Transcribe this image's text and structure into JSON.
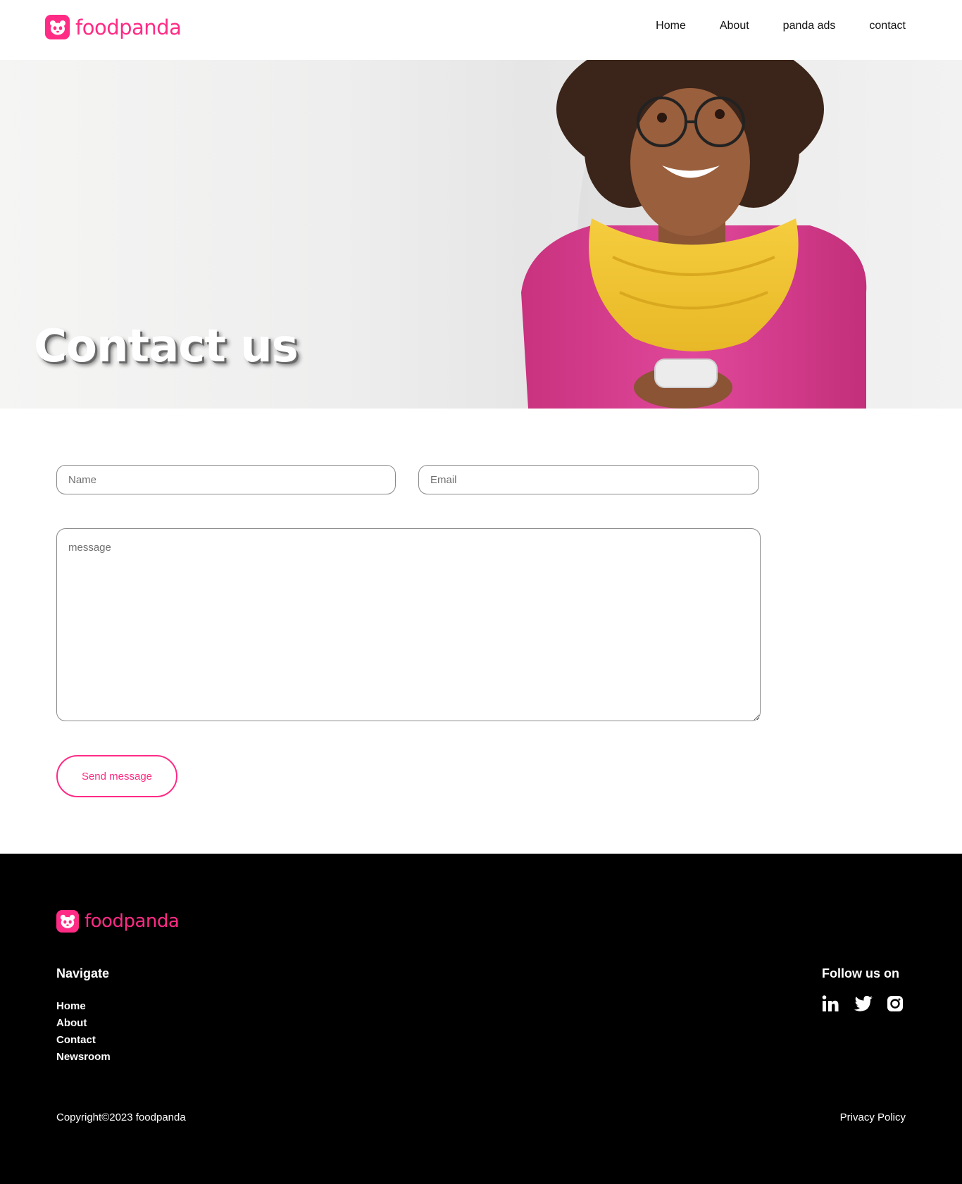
{
  "brand": {
    "name": "foodpanda",
    "accent_color": "#ff2b85",
    "logo_icon": "panda-face-icon"
  },
  "nav": {
    "items": [
      {
        "label": "Home"
      },
      {
        "label": "About"
      },
      {
        "label": "panda ads"
      },
      {
        "label": "contact"
      }
    ]
  },
  "hero": {
    "title": "Contact us",
    "image": "woman-with-phone-photo"
  },
  "form": {
    "name_placeholder": "Name",
    "email_placeholder": "Email",
    "message_placeholder": "message",
    "send_label": "Send message"
  },
  "footer": {
    "navigate_heading": "Navigate",
    "links": [
      {
        "label": "Home"
      },
      {
        "label": "About"
      },
      {
        "label": "Contact"
      },
      {
        "label": "Newsroom"
      }
    ],
    "follow_heading": "Follow us on",
    "social": [
      "linkedin-icon",
      "twitter-icon",
      "instagram-icon"
    ],
    "copyright": "Copyright©2023 foodpanda",
    "privacy": "Privacy Policy",
    "background": "#000000"
  }
}
